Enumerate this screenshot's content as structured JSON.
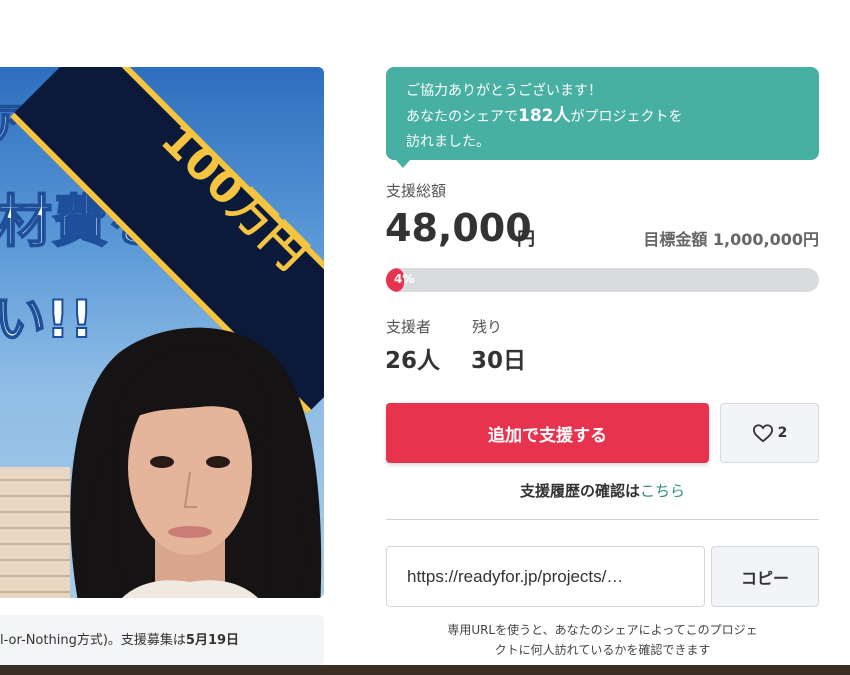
{
  "hero": {
    "text_line1": "アへ",
    "text_line2": "材費を",
    "text_line3": "い!!",
    "sash_text": "100万円"
  },
  "caption": {
    "prefix": "l-or-Nothing方式)。支援募集は",
    "date": "5月19日"
  },
  "share_toast": {
    "line1": "ご協力ありがとうございます！",
    "line2_prefix": "あなたのシェアで",
    "count": "182人",
    "line2_suffix": "がプロジェクトを",
    "line3": "訪れました。",
    "color": "#47b0a2"
  },
  "funding": {
    "total_label": "支援総額",
    "amount": "48,000",
    "currency": "円",
    "goal_label": "目標金額",
    "goal_amount": "1,000,000円",
    "progress_percent": 4,
    "progress_label": "4%"
  },
  "stats": {
    "supporters_label": "支援者",
    "supporters_value": "26人",
    "remaining_label": "残り",
    "remaining_value": "30日"
  },
  "actions": {
    "support_button": "追加で支援する",
    "favorite_count": "2",
    "history_text": "支援履歴の確認は",
    "history_link": "こちら",
    "accent_color": "#e8334f"
  },
  "share": {
    "url_value": "https://readyfor.jp/projects/…",
    "copy_button": "コピー",
    "note_line1": "専用URLを使うと、あなたのシェアによってこのプロジェ",
    "note_line2": "クトに何人訪れているかを確認できます"
  }
}
